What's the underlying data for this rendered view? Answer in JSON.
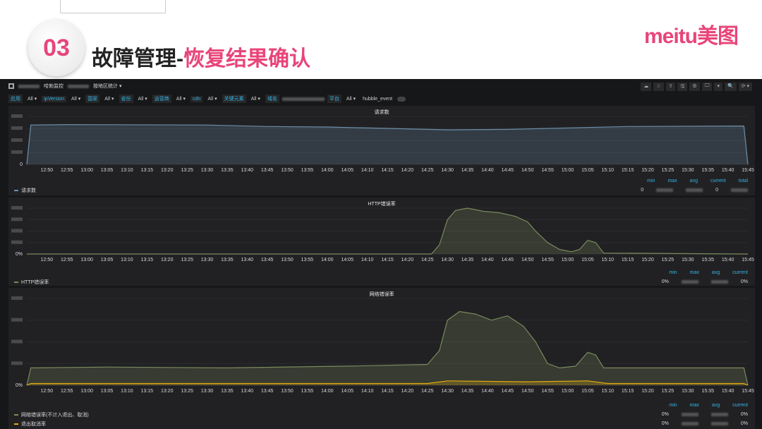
{
  "slide": {
    "number": "03",
    "title_main": "故障管理-",
    "title_accent": "恢复结果确认",
    "logo": "meitu美图"
  },
  "nav": {
    "breadcrumb": "哈勃监控",
    "dashboard": "按地区统计 ▾"
  },
  "toolbar": [
    "☁",
    "☆",
    "⇪",
    "🖫",
    "⚙",
    "🖵",
    "▾",
    "🔍",
    "⟳ ▾"
  ],
  "variables": [
    {
      "label": "应用",
      "value": "All ▾"
    },
    {
      "label": "ipVersion",
      "value": "All ▾"
    },
    {
      "label": "国家",
      "value": "All ▾"
    },
    {
      "label": "省份",
      "value": "All ▾"
    },
    {
      "label": "运营商",
      "value": "All ▾"
    },
    {
      "label": "cdn",
      "value": "All ▾"
    },
    {
      "label": "关键元素",
      "value": "All ▾"
    },
    {
      "label": "域名",
      "value": ""
    },
    {
      "label": "平台",
      "value": "All ▾"
    }
  ],
  "hubble_toggle": "hubble_event",
  "x_ticks": [
    "12:50",
    "12:55",
    "13:00",
    "13:05",
    "13:10",
    "13:15",
    "13:20",
    "13:25",
    "13:30",
    "13:35",
    "13:40",
    "13:45",
    "13:50",
    "13:55",
    "14:00",
    "14:05",
    "14:10",
    "14:15",
    "14:20",
    "14:25",
    "14:30",
    "14:35",
    "14:40",
    "14:45",
    "14:50",
    "14:55",
    "15:00",
    "15:05",
    "15:10",
    "15:15",
    "15:20",
    "15:25",
    "15:30",
    "15:35",
    "15:40",
    "15:45"
  ],
  "chart_data": [
    {
      "type": "area",
      "title": "请求数",
      "y_zero_label": "0",
      "x_unit": "minutes after 12:45",
      "series": [
        {
          "name": "请求数",
          "color": "#6d8fa8",
          "points": [
            [
              0,
              0
            ],
            [
              1,
              0.82
            ],
            [
              10,
              0.83
            ],
            [
              45,
              0.82
            ],
            [
              60,
              0.79
            ],
            [
              75,
              0.78
            ],
            [
              105,
              0.72
            ],
            [
              120,
              0.73
            ],
            [
              135,
              0.76
            ],
            [
              150,
              0.79
            ],
            [
              179,
              0.8
            ],
            [
              180,
              0
            ]
          ]
        }
      ],
      "legend": {
        "headers": [
          "min",
          "max",
          "avg",
          "current",
          "total"
        ],
        "rows": [
          {
            "name": "请求数",
            "values": [
              "0",
              "",
              "",
              "0",
              ""
            ]
          }
        ]
      }
    },
    {
      "type": "area",
      "title": "HTTP错误率",
      "y_zero_label": "0%",
      "x_unit": "minutes after 12:45",
      "series": [
        {
          "name": "HTTP错误率",
          "color": "#7a8a5a",
          "points": [
            [
              0,
              0
            ],
            [
              101,
              0
            ],
            [
              103,
              0.2
            ],
            [
              105,
              0.75
            ],
            [
              107,
              0.95
            ],
            [
              110,
              1.0
            ],
            [
              114,
              0.93
            ],
            [
              118,
              0.9
            ],
            [
              122,
              0.82
            ],
            [
              125,
              0.7
            ],
            [
              127,
              0.5
            ],
            [
              130,
              0.25
            ],
            [
              133,
              0.1
            ],
            [
              136,
              0.05
            ],
            [
              138,
              0.1
            ],
            [
              140,
              0.3
            ],
            [
              142,
              0.25
            ],
            [
              144,
              0.02
            ],
            [
              180,
              0
            ]
          ]
        }
      ],
      "legend": {
        "headers": [
          "min",
          "max",
          "avg",
          "current"
        ],
        "rows": [
          {
            "name": "HTTP错误率",
            "values": [
              "0%",
              "",
              "",
              "0%"
            ]
          }
        ]
      }
    },
    {
      "type": "area",
      "title": "网络错误率",
      "y_zero_label": "0%",
      "x_unit": "minutes after 12:45",
      "series": [
        {
          "name": "网络错误率(不计入退出、取消)",
          "color": "#7a8a5a",
          "points": [
            [
              0,
              0
            ],
            [
              1,
              0.2
            ],
            [
              20,
              0.21
            ],
            [
              50,
              0.2
            ],
            [
              80,
              0.22
            ],
            [
              100,
              0.24
            ],
            [
              103,
              0.4
            ],
            [
              105,
              0.75
            ],
            [
              108,
              0.85
            ],
            [
              112,
              0.82
            ],
            [
              116,
              0.75
            ],
            [
              120,
              0.8
            ],
            [
              124,
              0.68
            ],
            [
              127,
              0.5
            ],
            [
              130,
              0.25
            ],
            [
              133,
              0.2
            ],
            [
              137,
              0.22
            ],
            [
              140,
              0.38
            ],
            [
              142,
              0.35
            ],
            [
              144,
              0.2
            ],
            [
              160,
              0.2
            ],
            [
              179,
              0.2
            ],
            [
              180,
              0
            ]
          ]
        },
        {
          "name": "退出取消率",
          "color": "#e5ac0e",
          "points": [
            [
              0,
              0
            ],
            [
              1,
              0.02
            ],
            [
              100,
              0.02
            ],
            [
              105,
              0.05
            ],
            [
              125,
              0.04
            ],
            [
              140,
              0.05
            ],
            [
              145,
              0.02
            ],
            [
              179,
              0.02
            ],
            [
              180,
              0
            ]
          ]
        }
      ],
      "legend": {
        "headers": [
          "min",
          "max",
          "avg",
          "current"
        ],
        "rows": [
          {
            "name": "网络错误率(不计入退出、取消)",
            "values": [
              "0%",
              "",
              "",
              "0%"
            ]
          },
          {
            "name": "退出取消率",
            "values": [
              "0%",
              "",
              "",
              "0%"
            ]
          }
        ]
      }
    }
  ]
}
